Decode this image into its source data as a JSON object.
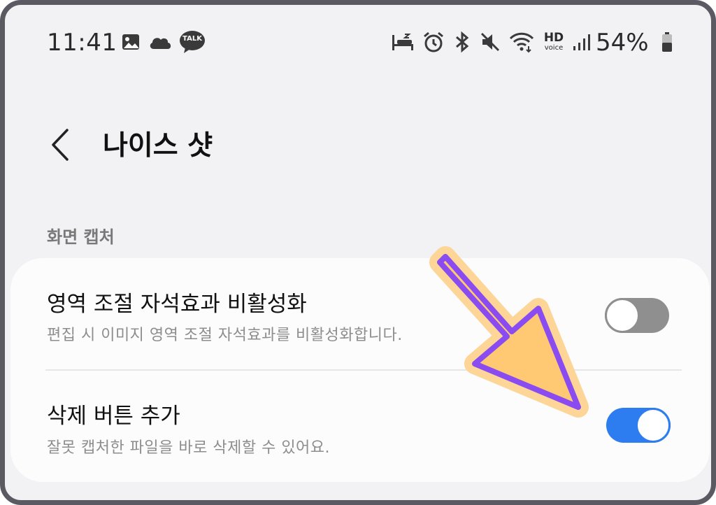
{
  "status_bar": {
    "time": "11:41",
    "kakao_label": "TALK",
    "hd_label": "HD",
    "voice_label": "voice",
    "battery": "54%",
    "left_icons": [
      "image-icon",
      "cloud-icon",
      "kakaotalk-icon"
    ],
    "right_icons": [
      "bed-icon",
      "alarm-icon",
      "bluetooth-icon",
      "mute-icon",
      "wifi-icon",
      "hd-voice-icon",
      "signal-icon",
      "battery-icon"
    ]
  },
  "header": {
    "back_icon": "chevron-left-icon",
    "title": "나이스 샷"
  },
  "section": {
    "title": "화면 캡처"
  },
  "settings": [
    {
      "title": "영역 조절 자석효과 비활성화",
      "description": "편집 시 이미지 영역 조절 자석효과를 비활성화합니다.",
      "enabled": false
    },
    {
      "title": "삭제 버튼 추가",
      "description": "잘못 캡처한 파일을 바로 삭제할 수 있어요.",
      "enabled": true
    }
  ],
  "annotation": {
    "icon": "arrow-icon",
    "fill": "#ffc873",
    "outline": "#8a4cf0"
  },
  "colors": {
    "toggle_on": "#2d7cf0",
    "toggle_off": "#8f8f8f",
    "background": "#f2f2f4",
    "card": "#fcfcfd"
  }
}
